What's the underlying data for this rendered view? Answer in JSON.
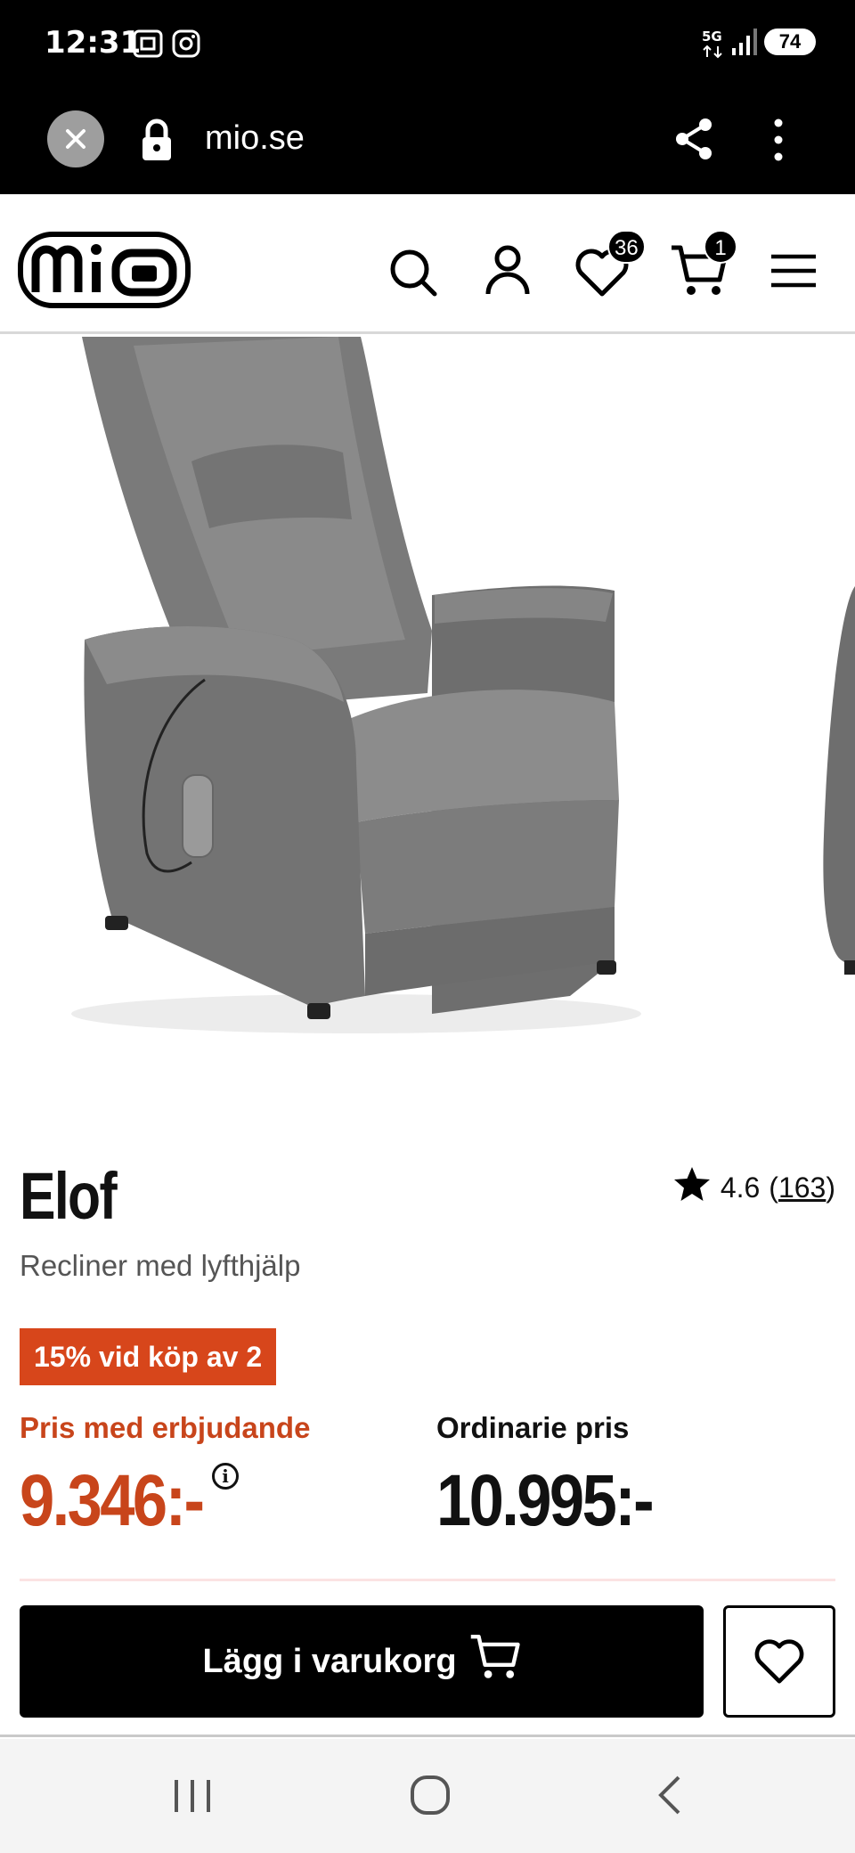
{
  "status_bar": {
    "time": "12:31",
    "battery": "74",
    "network": "5G"
  },
  "browser": {
    "url": "mio.se"
  },
  "header": {
    "logo": "mio",
    "wishlist_count": "36",
    "cart_count": "1"
  },
  "product": {
    "name": "Elof",
    "subtitle": "Recliner med lyfthjälp",
    "rating": "4.6",
    "review_count": "163",
    "promo_badge": "15% vid köp av 2",
    "offer_label": "Pris med erbjudande",
    "offer_price": "9.346:-",
    "regular_label": "Ordinarie pris",
    "regular_price": "10.995:-"
  },
  "actions": {
    "add_to_cart": "Lägg i varukorg"
  },
  "colors": {
    "accent": "#d7461b",
    "primary": "#000000"
  }
}
